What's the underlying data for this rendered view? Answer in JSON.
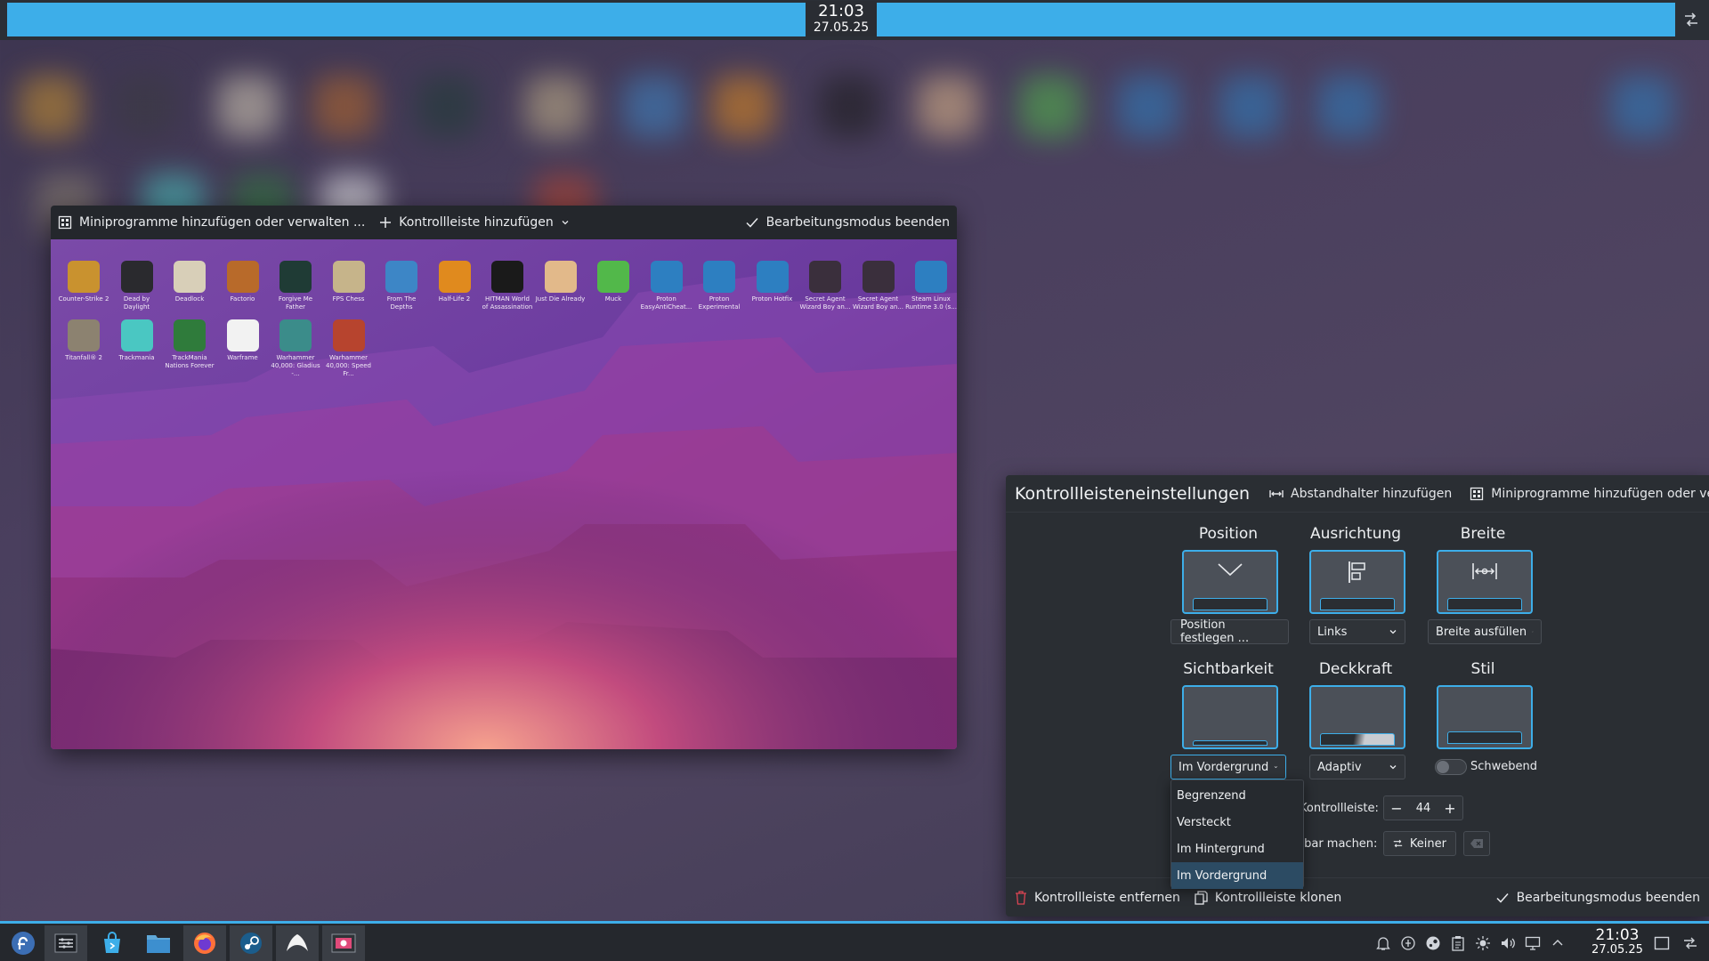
{
  "top_panel": {
    "time": "21:03",
    "date": "27.05.25",
    "config_icon": "panel-config-icon",
    "accent": "#3daee9"
  },
  "preview": {
    "toolbar": {
      "widgets_label": "Miniprogramme hinzufügen oder verwalten ...",
      "add_panel_label": "Kontrollleiste hinzufügen",
      "exit_label": "Bearbeitungsmodus beenden"
    },
    "desktop_icons": [
      {
        "label": "Counter-Strike 2",
        "color": "#c9922f"
      },
      {
        "label": "Dead by Daylight",
        "color": "#2a2a2e"
      },
      {
        "label": "Deadlock",
        "color": "#d8cfb8"
      },
      {
        "label": "Factorio",
        "color": "#b86a2a"
      },
      {
        "label": "Forgive Me Father",
        "color": "#1f3b35"
      },
      {
        "label": "FPS Chess",
        "color": "#c6b48a"
      },
      {
        "label": "From The Depths",
        "color": "#3d86c6"
      },
      {
        "label": "Half-Life 2",
        "color": "#e08a1e"
      },
      {
        "label": "HITMAN World of Assassination",
        "color": "#1a1a1a"
      },
      {
        "label": "Just Die Already",
        "color": "#e2b98a"
      },
      {
        "label": "Muck",
        "color": "#52b84a"
      },
      {
        "label": "Proton EasyAntiCheat...",
        "color": "#2d7fc1"
      },
      {
        "label": "Proton Experimental",
        "color": "#2d7fc1"
      },
      {
        "label": "Proton Hotfix",
        "color": "#2d7fc1"
      },
      {
        "label": "Secret Agent Wizard Boy an...",
        "color": "#3a2f3c"
      },
      {
        "label": "Secret Agent Wizard Boy an...",
        "color": "#3a2f3c"
      },
      {
        "label": "Steam Linux Runtime 3.0 (s...",
        "color": "#2d7fc1"
      },
      {
        "label": "Titanfall® 2",
        "color": "#8c8270"
      },
      {
        "label": "Trackmania",
        "color": "#4ac7c2"
      },
      {
        "label": "TrackMania Nations Forever",
        "color": "#2f7b3b"
      },
      {
        "label": "Warframe",
        "color": "#f2f2f2"
      },
      {
        "label": "Warhammer 40,000: Gladius -...",
        "color": "#3b8c8a"
      },
      {
        "label": "Warhammer 40,000: Speed Fr...",
        "color": "#b7442e"
      }
    ]
  },
  "dialog": {
    "title": "Kontrollleisteneinstellungen",
    "add_spacer_label": "Abstandhalter hinzufügen",
    "widgets_label": "Miniprogramme hinzufügen oder verwalten ...",
    "position": {
      "label": "Position",
      "button": "Position festlegen ..."
    },
    "alignment": {
      "label": "Ausrichtung",
      "value": "Links"
    },
    "width": {
      "label": "Breite",
      "value": "Breite ausfüllen"
    },
    "visibility": {
      "label": "Sichtbarkeit",
      "value": "Im Vordergrund"
    },
    "opacity": {
      "label": "Deckkraft",
      "value": "Adaptiv"
    },
    "style": {
      "label": "Stil",
      "floating_label": "Schwebend"
    },
    "height_label": "Kontrollleiste:",
    "height_value": "44",
    "shortcut_label": "tbar machen:",
    "shortcut_value": "Keiner",
    "footer": {
      "remove_label": "Kontrollleiste entfernen",
      "clone_label": "Kontrollleiste klonen",
      "exit_label": "Bearbeitungsmodus beenden"
    },
    "visibility_options": [
      "Begrenzend",
      "Versteckt",
      "Im Hintergrund",
      "Im Vordergrund"
    ],
    "visibility_selected": "Im Vordergrund"
  },
  "taskbar": {
    "time": "21:03",
    "date": "27.05.25",
    "apps": [
      "fedora-launcher-icon",
      "panel-settings-icon",
      "discover-icon",
      "file-manager-icon",
      "firefox-icon",
      "steam-icon",
      "warframe-icon",
      "screenshot-tool-icon"
    ],
    "tray": [
      "notifications-icon",
      "network-icon",
      "steam-tray-icon",
      "clipboard-icon",
      "brightness-icon",
      "volume-icon",
      "display-icon",
      "expand-tray-icon"
    ]
  }
}
